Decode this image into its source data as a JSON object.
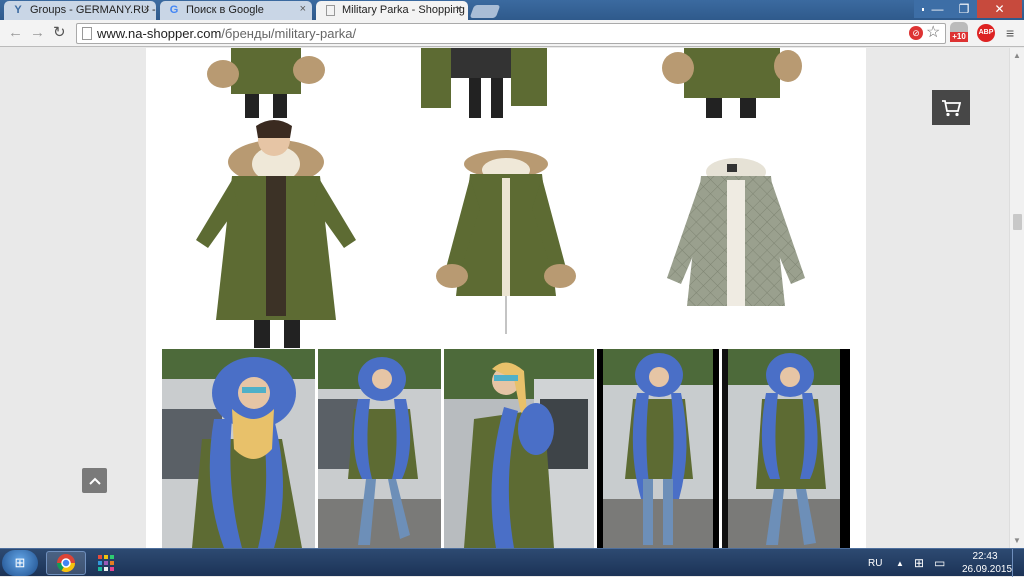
{
  "browser": {
    "tabs": [
      {
        "title": "Groups - GERMANY.RU -",
        "icon": "groups-favicon"
      },
      {
        "title": "Поиск в Google",
        "icon": "google-favicon"
      },
      {
        "title": "Military Parka - Shopping",
        "icon": "page-favicon"
      }
    ],
    "close_glyph": "×",
    "url_host": "www.na-shopper.com",
    "url_path": "/бренды/military-parka/",
    "ext_badge": "+10",
    "abp_label": "ABP",
    "star_glyph": "☆"
  },
  "page": {
    "cart_icon": "shopping-cart-icon",
    "to_top_icon": "chevron-up-icon"
  },
  "taskbar": {
    "lang": "RU",
    "time": "22:43",
    "date": "26.09.2015"
  },
  "colors": {
    "parka_green": "#5d6b33",
    "fur_beige": "#b89a72",
    "fur_blue": "#4a6fc7",
    "quilted_grey": "#9aa08e",
    "cart_bg": "#474747"
  }
}
